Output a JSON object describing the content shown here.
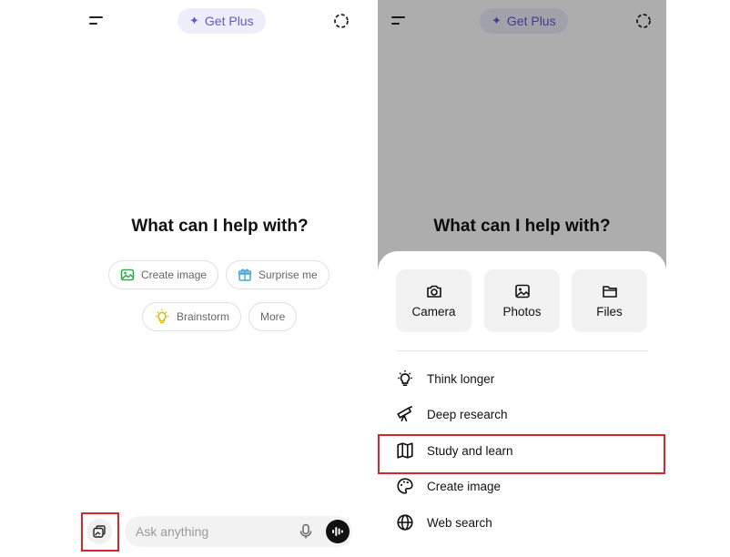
{
  "header": {
    "get_plus_label": "Get Plus"
  },
  "main": {
    "headline": "What can I help with?"
  },
  "chips": [
    {
      "label": "Create image",
      "icon": "image-icon",
      "color": "#2eaa4f"
    },
    {
      "label": "Surprise me",
      "icon": "gift-icon",
      "color": "#4aa8d8"
    },
    {
      "label": "Brainstorm",
      "icon": "lightbulb-icon",
      "color": "#e0b400"
    },
    {
      "label": "More"
    }
  ],
  "composer": {
    "placeholder": "Ask anything"
  },
  "attach_sheet": {
    "tiles": [
      {
        "label": "Camera",
        "icon": "camera-icon"
      },
      {
        "label": "Photos",
        "icon": "photos-icon"
      },
      {
        "label": "Files",
        "icon": "folder-icon"
      }
    ],
    "options": [
      {
        "label": "Think longer",
        "icon": "lightbulb-icon"
      },
      {
        "label": "Deep research",
        "icon": "telescope-icon"
      },
      {
        "label": "Study and learn",
        "icon": "book-icon"
      },
      {
        "label": "Create image",
        "icon": "palette-icon"
      },
      {
        "label": "Web search",
        "icon": "globe-icon"
      }
    ]
  },
  "colors": {
    "accent": "#5b5bd6",
    "highlight": "#d9262c"
  }
}
